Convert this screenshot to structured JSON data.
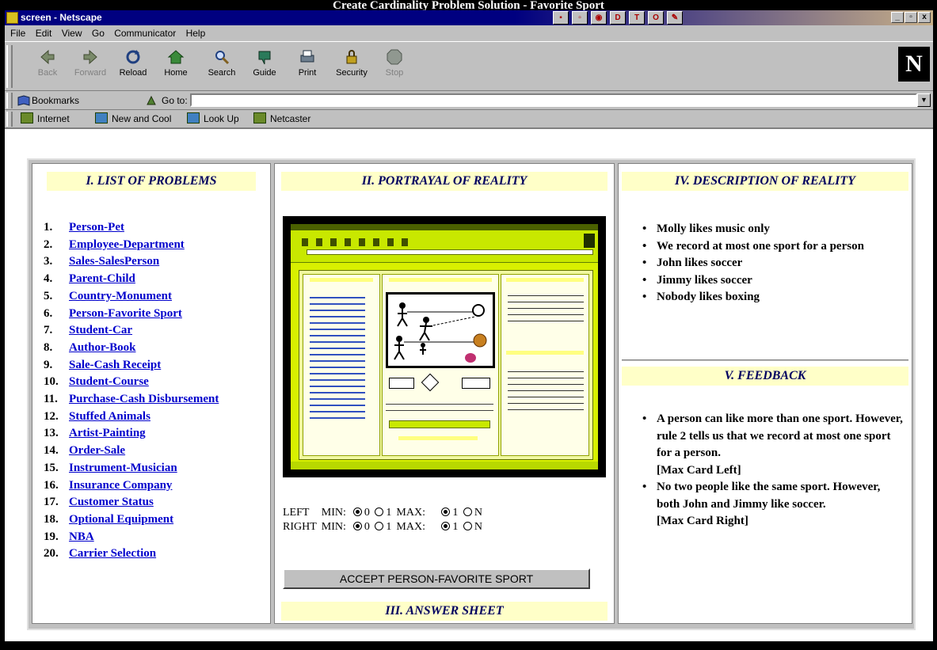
{
  "banner": "Create Cardinality Problem Solution - Favorite Sport",
  "window": {
    "title": "screen - Netscape",
    "controls": [
      "_",
      "▫",
      "x"
    ]
  },
  "menu": [
    "File",
    "Edit",
    "View",
    "Go",
    "Communicator",
    "Help"
  ],
  "toolbar": {
    "buttons": [
      {
        "label": "Back",
        "disabled": true
      },
      {
        "label": "Forward",
        "disabled": true
      },
      {
        "label": "Reload",
        "disabled": false
      },
      {
        "label": "Home",
        "disabled": false
      },
      {
        "label": "Search",
        "disabled": false
      },
      {
        "label": "Guide",
        "disabled": false
      },
      {
        "label": "Print",
        "disabled": false
      },
      {
        "label": "Security",
        "disabled": false
      },
      {
        "label": "Stop",
        "disabled": true
      }
    ],
    "logo": "N"
  },
  "location": {
    "bookmarks_label": "Bookmarks",
    "goto_label": "Go to:",
    "url": ""
  },
  "personal_toolbar": [
    "Internet",
    "New and Cool",
    "Look Up",
    "Netcaster"
  ],
  "sections": {
    "problems": "I. LIST OF PROBLEMS",
    "portrayal": "II. PORTRAYAL OF REALITY",
    "answer": "III. ANSWER SHEET",
    "description": "IV. DESCRIPTION OF REALITY",
    "feedback": "V. FEEDBACK"
  },
  "problems": [
    {
      "num": "1.",
      "label": "Person-Pet"
    },
    {
      "num": "2.",
      "label": "Employee-Department"
    },
    {
      "num": "3.",
      "label": "Sales-SalesPerson"
    },
    {
      "num": "4.",
      "label": "Parent-Child"
    },
    {
      "num": "5.",
      "label": "Country-Monument"
    },
    {
      "num": "6.",
      "label": "Person-Favorite Sport"
    },
    {
      "num": "7.",
      "label": "Student-Car"
    },
    {
      "num": "8.",
      "label": "Author-Book"
    },
    {
      "num": "9.",
      "label": "Sale-Cash Receipt"
    },
    {
      "num": "10.",
      "label": "Student-Course"
    },
    {
      "num": "11.",
      "label": "Purchase-Cash Disbursement"
    },
    {
      "num": "12.",
      "label": "Stuffed Animals"
    },
    {
      "num": "13.",
      "label": "Artist-Painting"
    },
    {
      "num": "14.",
      "label": "Order-Sale"
    },
    {
      "num": "15.",
      "label": "Instrument-Musician"
    },
    {
      "num": "16.",
      "label": "Insurance Company"
    },
    {
      "num": "17.",
      "label": "Customer Status"
    },
    {
      "num": "18.",
      "label": "Optional Equipment"
    },
    {
      "num": "19.",
      "label": "NBA"
    },
    {
      "num": "20.",
      "label": "Carrier Selection"
    }
  ],
  "cardinality": {
    "left": {
      "label": "LEFT",
      "min_label": "MIN:",
      "min_options": [
        "0",
        "1"
      ],
      "min_selected": "0",
      "max_label": "MAX:",
      "max_options": [
        "1",
        "N"
      ],
      "max_selected": "1"
    },
    "right": {
      "label": "RIGHT",
      "min_label": "MIN:",
      "min_options": [
        "0",
        "1"
      ],
      "min_selected": "0",
      "max_label": "MAX:",
      "max_options": [
        "1",
        "N"
      ],
      "max_selected": "1"
    }
  },
  "accept_button": "ACCEPT PERSON-FAVORITE SPORT",
  "description": [
    "Molly likes music only",
    "We record at most one sport for a person",
    "John likes soccer",
    "Jimmy likes soccer",
    "Nobody likes boxing"
  ],
  "feedback": [
    {
      "text": "A person can like more than one sport. However, rule 2 tells us that we record at most one sport for a person.",
      "tag": "[Max Card Left]"
    },
    {
      "text": "No two people like the same sport. However, both John and Jimmy like soccer.",
      "tag": "[Max Card Right]"
    }
  ],
  "colors": {
    "header_bg": "#ffffc8",
    "header_text": "#000060",
    "link": "#0000cc",
    "titlebar": "#000080",
    "chrome": "#c0c0c0"
  }
}
